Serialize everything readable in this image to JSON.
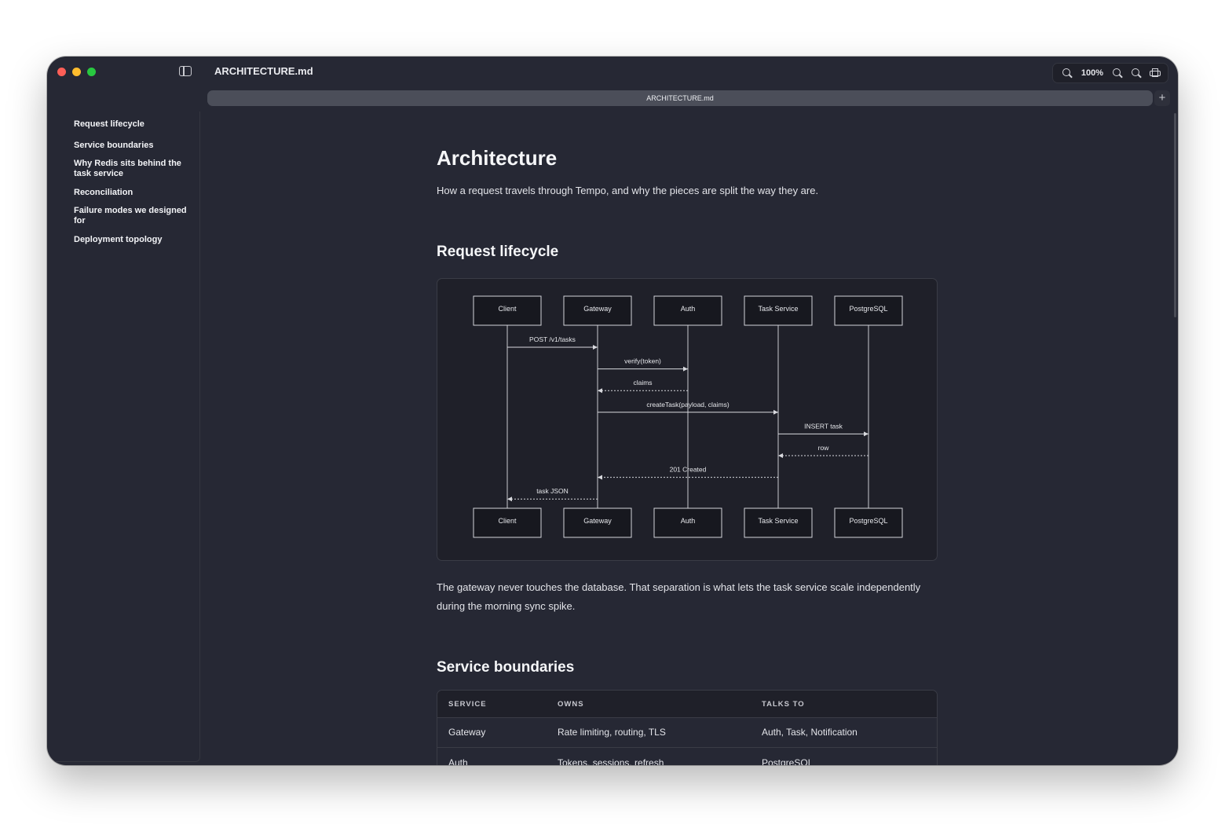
{
  "window": {
    "title": "ARCHITECTURE.md",
    "zoom_level": "100%",
    "tab_label": "ARCHITECTURE.md",
    "new_tab_label": "+",
    "icons": [
      "sidebar-toggle-icon",
      "zoom-out-icon",
      "zoom-in-icon",
      "zoom-reset-icon",
      "print-icon",
      "plus-icon"
    ]
  },
  "toc": {
    "items": [
      {
        "label": "Request lifecycle"
      },
      {
        "label": "Service boundaries"
      },
      {
        "label": "Why Redis sits behind the task service"
      },
      {
        "label": "Reconciliation"
      },
      {
        "label": "Failure modes we designed for"
      },
      {
        "label": "Deployment topology"
      }
    ]
  },
  "doc": {
    "title": "Architecture",
    "intro": "How a request travels through Tempo, and why the pieces are split the way they are.",
    "section1_heading": "Request lifecycle",
    "section1_para": "The gateway never touches the database. That separation is what lets the task service scale independently during the morning sync spike.",
    "section2_heading": "Service boundaries"
  },
  "sequence": {
    "participants": [
      "Client",
      "Gateway",
      "Auth",
      "Task Service",
      "PostgreSQL"
    ],
    "messages": [
      {
        "from": 0,
        "to": 1,
        "label": "POST /v1/tasks",
        "dashed": false
      },
      {
        "from": 1,
        "to": 2,
        "label": "verify(token)",
        "dashed": false
      },
      {
        "from": 2,
        "to": 1,
        "label": "claims",
        "dashed": true
      },
      {
        "from": 1,
        "to": 3,
        "label": "createTask(payload, claims)",
        "dashed": false
      },
      {
        "from": 3,
        "to": 4,
        "label": "INSERT task",
        "dashed": false
      },
      {
        "from": 4,
        "to": 3,
        "label": "row",
        "dashed": true
      },
      {
        "from": 3,
        "to": 1,
        "label": "201 Created",
        "dashed": true
      },
      {
        "from": 1,
        "to": 0,
        "label": "task JSON",
        "dashed": true
      }
    ]
  },
  "table": {
    "headers": [
      "SERVICE",
      "OWNS",
      "TALKS TO"
    ],
    "rows": [
      [
        "Gateway",
        "Rate limiting, routing, TLS",
        "Auth, Task, Notification"
      ],
      [
        "Auth",
        "Tokens, sessions, refresh",
        "PostgreSQL"
      ]
    ]
  }
}
